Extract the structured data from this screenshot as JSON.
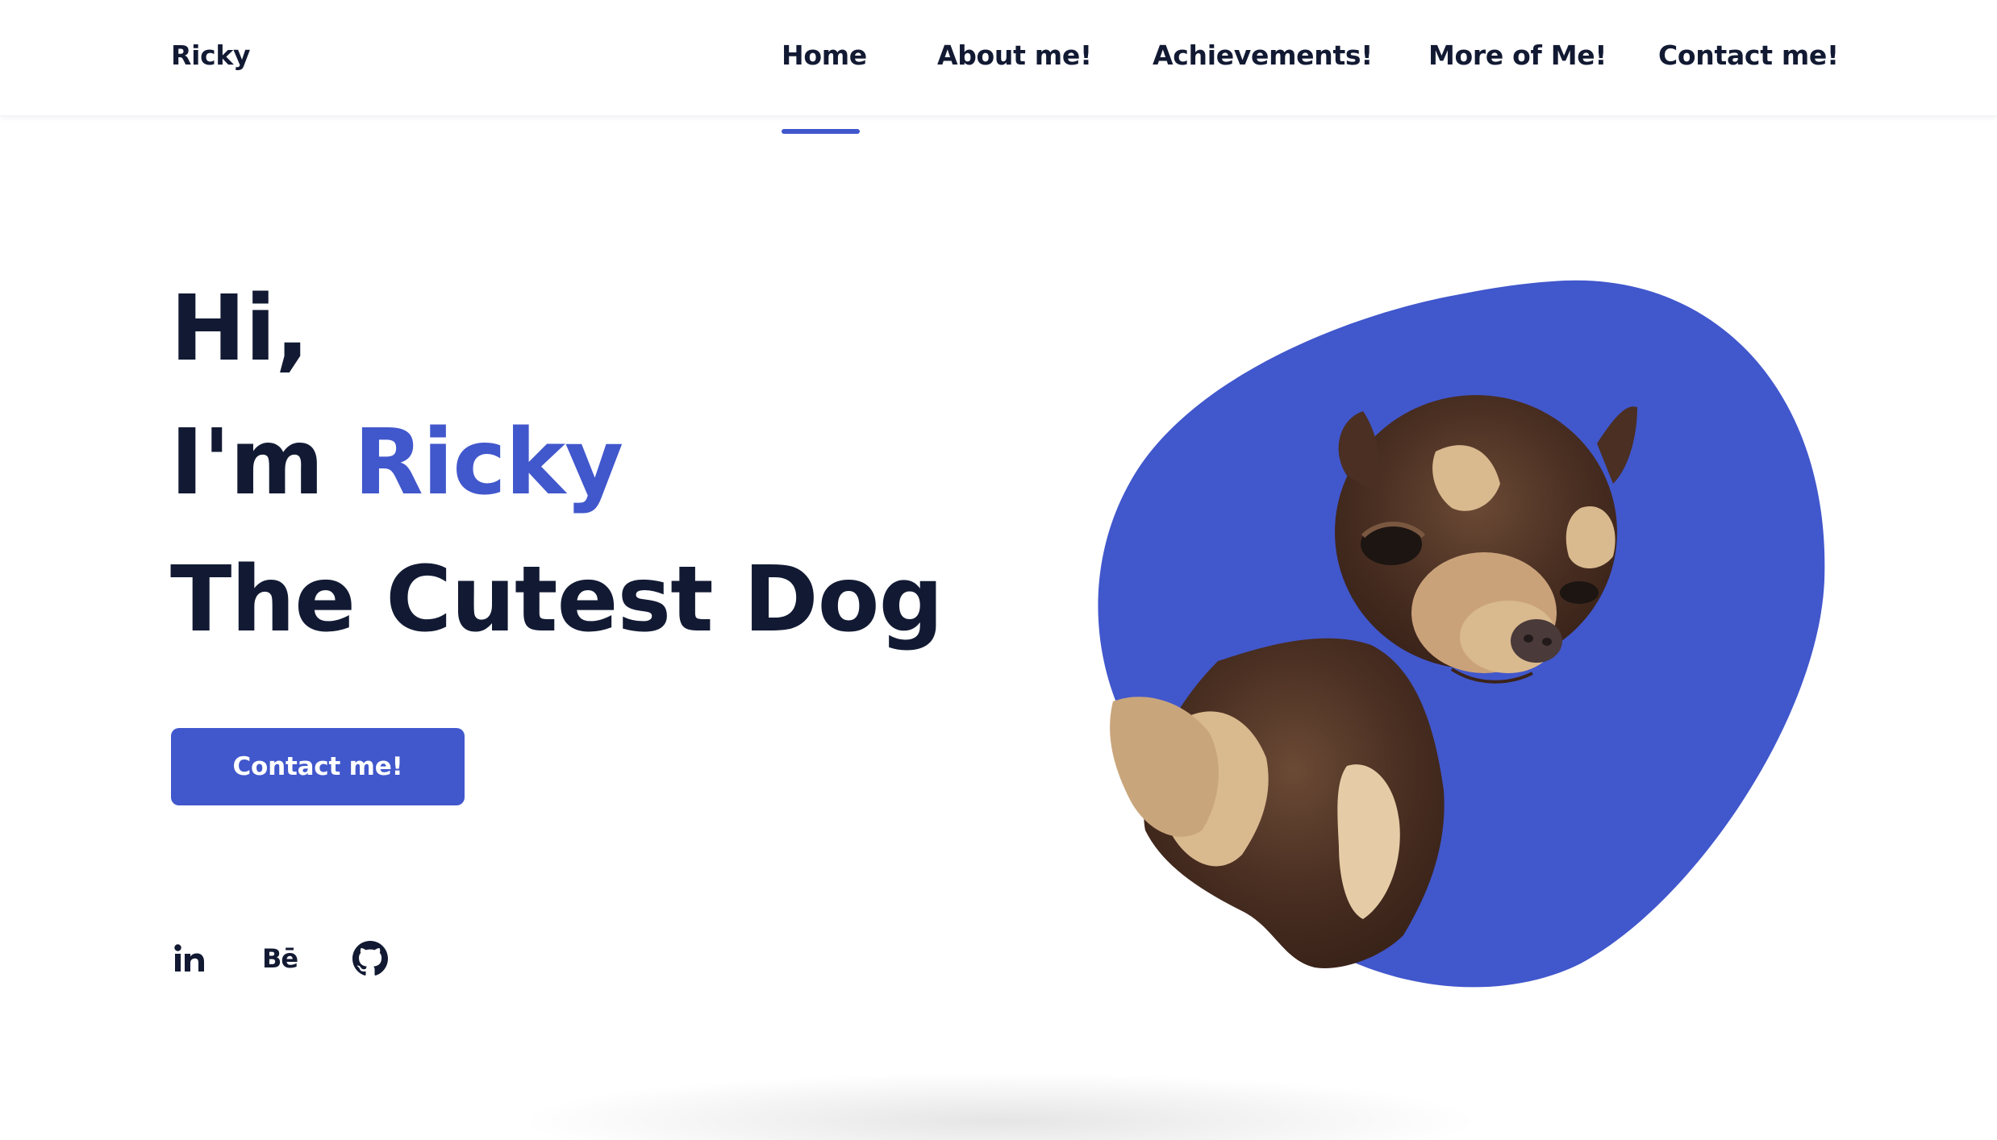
{
  "header": {
    "logo": "Ricky",
    "nav": [
      {
        "label": "Home",
        "active": true
      },
      {
        "label": "About me!"
      },
      {
        "label": "Achievements!"
      },
      {
        "label": "More of Me!"
      },
      {
        "label": "Contact me!"
      }
    ]
  },
  "hero": {
    "greeting": "Hi,",
    "intro_prefix": "I'm ",
    "name": "Ricky",
    "tagline": "The Cutest Dog",
    "cta_label": "Contact me!"
  },
  "social": [
    {
      "icon": "linkedin-icon"
    },
    {
      "icon": "behance-icon",
      "glyph": "Bē"
    },
    {
      "icon": "github-icon"
    }
  ],
  "colors": {
    "accent": "#4157cc",
    "text": "#121a33",
    "background": "#ffffff"
  },
  "illustration": {
    "subject": "chihuahua-photo",
    "backdrop": "blob"
  }
}
